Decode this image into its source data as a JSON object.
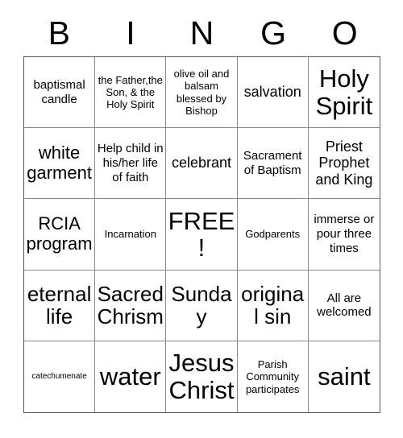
{
  "card": {
    "header_letters": [
      "B",
      "I",
      "N",
      "G",
      "O"
    ],
    "columns": [
      {
        "letter": "B",
        "cells": [
          {
            "text": "baptismal candle",
            "size": "sm"
          },
          {
            "text": "white garment",
            "size": "lg"
          },
          {
            "text": "RCIA program",
            "size": "lg"
          },
          {
            "text": "eternal life",
            "size": "xl"
          },
          {
            "text": "catechumenate",
            "size": "xxs"
          }
        ]
      },
      {
        "letter": "I",
        "cells": [
          {
            "text": "the Father,the Son, & the Holy Spirit",
            "size": "xs"
          },
          {
            "text": "Help child in his/her life of faith",
            "size": "sm"
          },
          {
            "text": "Incarnation",
            "size": "xs"
          },
          {
            "text": "Sacred Chrism",
            "size": "xl"
          },
          {
            "text": "water",
            "size": "xxl"
          }
        ]
      },
      {
        "letter": "N",
        "cells": [
          {
            "text": "olive oil and balsam blessed by Bishop",
            "size": "xs"
          },
          {
            "text": "celebrant",
            "size": "md"
          },
          {
            "text": "FREE!",
            "size": "xxl"
          },
          {
            "text": "Sunday",
            "size": "xl"
          },
          {
            "text": "Jesus Christ",
            "size": "xxl"
          }
        ]
      },
      {
        "letter": "G",
        "cells": [
          {
            "text": "salvation",
            "size": "md"
          },
          {
            "text": "Sacrament of Baptism",
            "size": "sm"
          },
          {
            "text": "Godparents",
            "size": "xs"
          },
          {
            "text": "original sin",
            "size": "xl"
          },
          {
            "text": "Parish Community participates",
            "size": "xs"
          }
        ]
      },
      {
        "letter": "O",
        "cells": [
          {
            "text": "Holy Spirit",
            "size": "xxl"
          },
          {
            "text": "Priest Prophet and King",
            "size": "md"
          },
          {
            "text": "immerse or pour three times",
            "size": "sm"
          },
          {
            "text": "All are welcomed",
            "size": "sm"
          },
          {
            "text": "saint",
            "size": "xxl"
          }
        ]
      }
    ],
    "free_space": {
      "label": "FREE!",
      "row": 3,
      "column": 3
    },
    "colors": {
      "background": "#ffffff",
      "text": "#000000",
      "outer_border": "#5a5a5a",
      "inner_border": "#8a8a8a"
    }
  }
}
